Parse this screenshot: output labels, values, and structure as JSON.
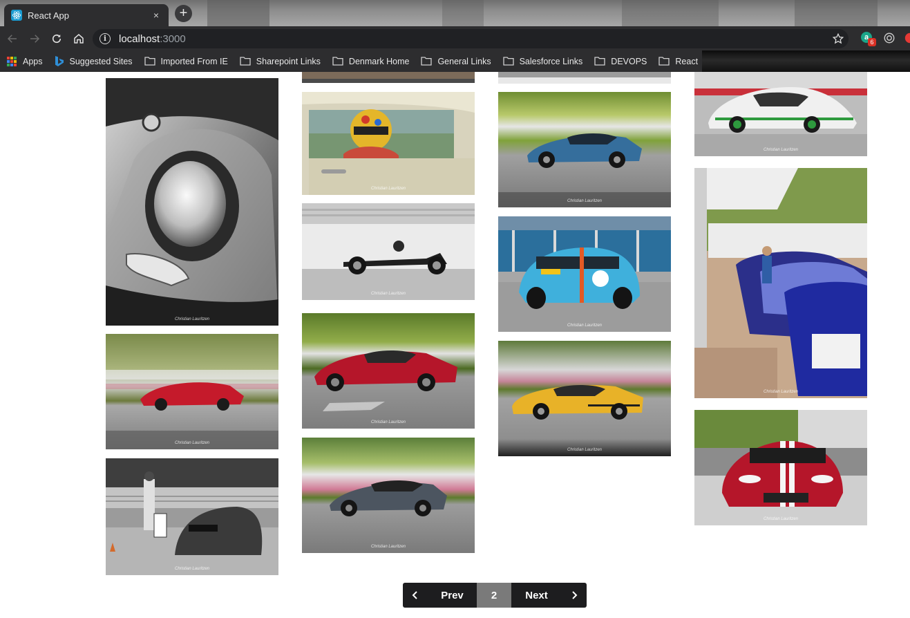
{
  "browser": {
    "tab_title": "React App",
    "tab_close": "×",
    "new_tab": "+",
    "url_host": "localhost",
    "url_port": ":3000",
    "extension_badge": "6",
    "extension_letter": "a"
  },
  "bookmarks": [
    {
      "label": "Apps",
      "type": "apps"
    },
    {
      "label": "Suggested Sites",
      "type": "bing"
    },
    {
      "label": "Imported From IE",
      "type": "folder"
    },
    {
      "label": "Sharepoint Links",
      "type": "folder"
    },
    {
      "label": "Denmark Home",
      "type": "folder"
    },
    {
      "label": "General Links",
      "type": "folder"
    },
    {
      "label": "Salesforce Links",
      "type": "folder"
    },
    {
      "label": "DEVOPS",
      "type": "folder"
    },
    {
      "label": "React",
      "type": "folder"
    }
  ],
  "pagination": {
    "prev_label": "Prev",
    "current_page": "2",
    "next_label": "Next"
  },
  "watermark": "Christian Lauritzen",
  "photos": [
    {
      "subject": "jaguar-headlight-bw"
    },
    {
      "subject": "ford-gt-red-panning"
    },
    {
      "subject": "marshal-and-e-type"
    },
    {
      "subject": "top-strip"
    },
    {
      "subject": "driver-helmet-window"
    },
    {
      "subject": "caterham-bw"
    },
    {
      "subject": "ford-gt-red-track"
    },
    {
      "subject": "nsx-grey-track"
    },
    {
      "subject": "top-strip"
    },
    {
      "subject": "nsx-blue-panning"
    },
    {
      "subject": "ford-gt-blue-paddock"
    },
    {
      "subject": "ford-gt-yellow-track"
    },
    {
      "subject": "porsche-carrera-white"
    },
    {
      "subject": "paddock-cars-lineup"
    },
    {
      "subject": "ford-gt-red-front"
    }
  ]
}
